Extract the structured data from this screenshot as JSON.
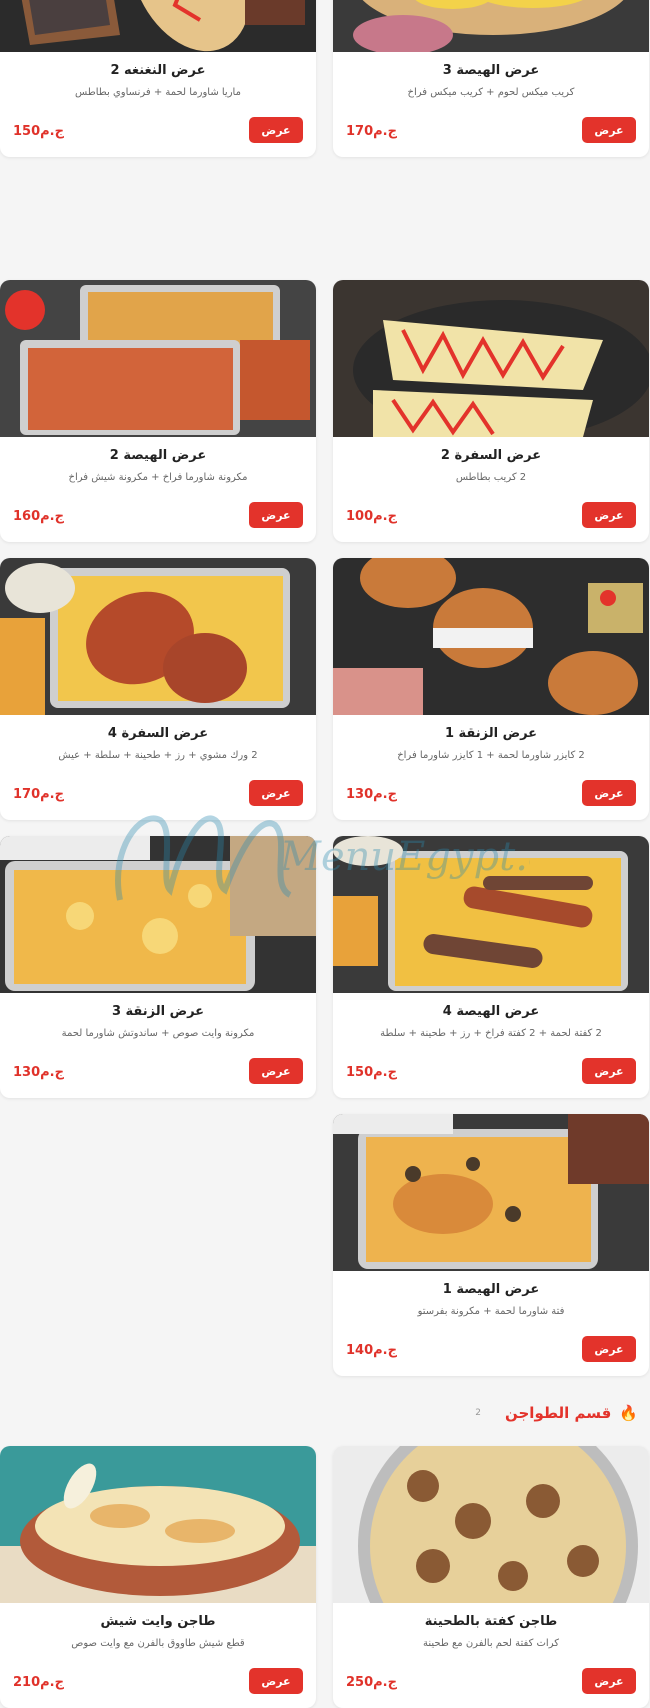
{
  "offers": [
    {
      "title": "عرض الهيصة 3",
      "desc": "كريب ميكس لحوم + كريب ميكس فراخ",
      "price": "170ج.م",
      "button": "عرض"
    },
    {
      "title": "عرض النغنغه 2",
      "desc": "ماريا شاورما لحمة + فرنساوي بطاطس",
      "price": "150ج.م",
      "button": "عرض"
    },
    {
      "title": "عرض السفرة 2",
      "desc": "2 كريب بطاطس",
      "price": "100ج.م",
      "button": "عرض"
    },
    {
      "title": "عرض الهيصة 2",
      "desc": "مكرونة شاورما فراخ + مكرونة شيش فراخ",
      "price": "160ج.م",
      "button": "عرض"
    },
    {
      "title": "عرض الزنقة 1",
      "desc": "2 كايزر شاورما لحمة + 1 كايزر شاورما فراخ",
      "price": "130ج.م",
      "button": "عرض"
    },
    {
      "title": "عرض السفرة 4",
      "desc": "2 ورك مشوي + رز + طحينة + سلطة + عيش",
      "price": "170ج.م",
      "button": "عرض"
    },
    {
      "title": "عرض الهيصة 4",
      "desc": "2 كفتة لحمة + 2 كفتة فراخ + رز + طحينة + سلطة",
      "price": "150ج.م",
      "button": "عرض"
    },
    {
      "title": "عرض الزنقة 3",
      "desc": "مكرونة وايت صوص + ساندوتش شاورما لحمة",
      "price": "130ج.م",
      "button": "عرض"
    },
    {
      "title": "عرض الهيصة 1",
      "desc": "فتة شاورما لحمة + مكرونة بفرستو",
      "price": "140ج.م",
      "button": "عرض"
    }
  ],
  "section": {
    "icon": "fire-icon",
    "name": "قسم الطواجن",
    "count": "2"
  },
  "tagines": [
    {
      "title": "طاجن كفتة بالطحينة",
      "desc": "كرات كفتة لحم بالفرن مع طحينة",
      "price": "250ج.م",
      "button": "عرض"
    },
    {
      "title": "طاجن وايت شيش",
      "desc": "قطع شيش طاووق بالفرن مع وايت صوص",
      "price": "210ج.م",
      "button": "عرض"
    }
  ],
  "watermark": "MenuEgypt.com",
  "colors": {
    "accent": "#e3332b",
    "background": "#f5f5f5",
    "card": "#ffffff"
  }
}
